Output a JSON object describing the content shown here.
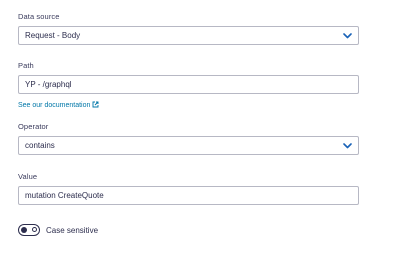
{
  "data_source": {
    "label": "Data source",
    "value": "Request - Body"
  },
  "path": {
    "label": "Path",
    "value": "YP - /graphql",
    "doc_link": "See our documentation"
  },
  "operator": {
    "label": "Operator",
    "value": "contains"
  },
  "value_field": {
    "label": "Value",
    "value": "mutation CreateQuote"
  },
  "case_sensitive": {
    "label": "Case sensitive"
  },
  "colors": {
    "text": "#2c2d4d",
    "border": "#b7b8c4",
    "link": "#0077a8",
    "chevron": "#1a63b8"
  },
  "icons": {
    "dropdown": "chevron-down-icon",
    "external_link": "external-link-icon",
    "toggle": "toggle-switch"
  }
}
